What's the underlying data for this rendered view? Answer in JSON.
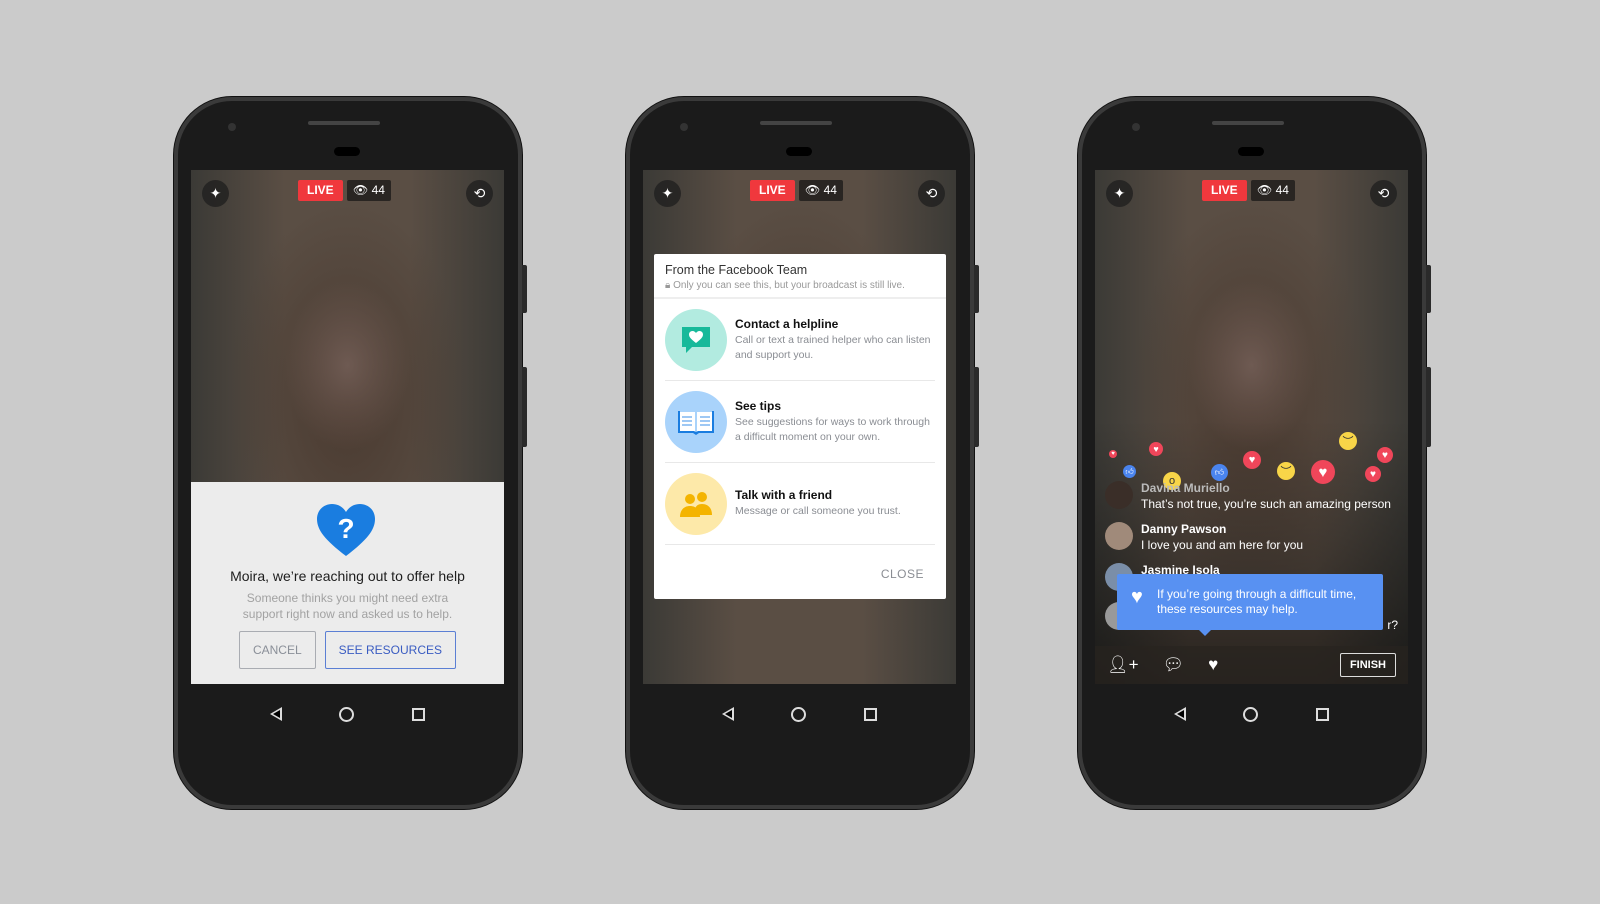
{
  "status": {
    "live": "LIVE",
    "viewers": "44"
  },
  "phone1": {
    "title": "Moira, we’re reaching out to offer help",
    "body_line1": "Someone thinks you might need extra",
    "body_line2": "support right now and asked us to help.",
    "cancel": "CANCEL",
    "see_resources": "SEE RESOURCES"
  },
  "phone2": {
    "header": "From the Facebook Team",
    "subheader": "Only you can see this, but your broadcast is still live.",
    "options": [
      {
        "title": "Contact a helpline",
        "desc": "Call or text a trained helper who can listen and support you.",
        "icon": "chat-heart-icon",
        "color": "#b2ebe0"
      },
      {
        "title": "See tips",
        "desc": "See suggestions for ways to work through a difficult moment on your own.",
        "icon": "book-icon",
        "color": "#a9d3fb"
      },
      {
        "title": "Talk with a friend",
        "desc": "Message or call someone you trust.",
        "icon": "friends-icon",
        "color": "#fde9a9"
      }
    ],
    "close": "CLOSE"
  },
  "phone3": {
    "comments": [
      {
        "name": "Davina Muriello",
        "message": "That’s not true, you’re such an amazing person"
      },
      {
        "name": "Danny Pawson",
        "message": "I love you and am here for you"
      },
      {
        "name": "Jasmine Isola",
        "message": ""
      }
    ],
    "partial_text": "r?",
    "tip": "If you’re going through a difficult time, these resources may help.",
    "finish": "FINISH"
  },
  "colors": {
    "live": "#f0383d",
    "accent": "#5891f2",
    "heart": "#1a7de0"
  }
}
